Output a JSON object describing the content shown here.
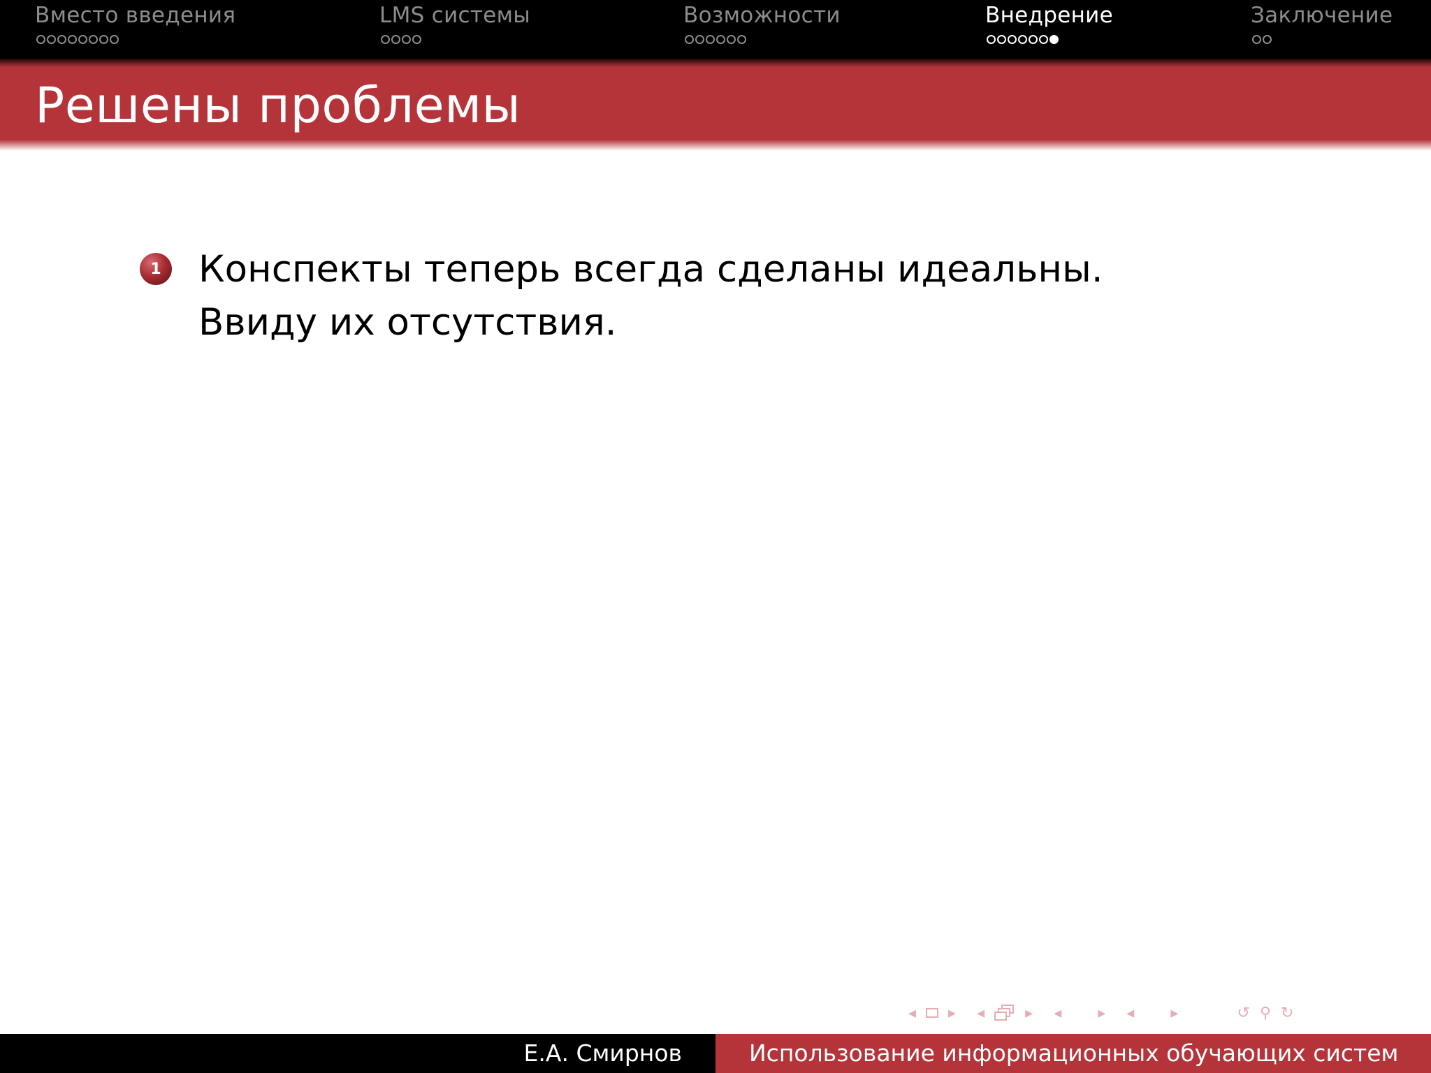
{
  "nav": {
    "sections": [
      {
        "title": "Вместо введения",
        "dots": 8,
        "current": -1,
        "active": false
      },
      {
        "title": "LMS системы",
        "dots": 4,
        "current": -1,
        "active": false
      },
      {
        "title": "Возможности",
        "dots": 6,
        "current": -1,
        "active": false
      },
      {
        "title": "Внедрение",
        "dots": 7,
        "current": 6,
        "active": true
      },
      {
        "title": "Заключение",
        "dots": 2,
        "current": -1,
        "active": false
      }
    ]
  },
  "frame": {
    "title": "Решены проблемы",
    "items": [
      {
        "number": "1",
        "text": "Конспекты теперь всегда сделаны идеальны. Ввиду их отсутствия."
      }
    ]
  },
  "footer": {
    "author": "Е.А. Смирнов",
    "talk_title": "Использование информационных обучающих систем"
  },
  "colors": {
    "accent": "#b4343a",
    "bar": "#000000",
    "nav_inactive": "#8c8c8c",
    "nav_symbols": "#e6aeb1"
  }
}
